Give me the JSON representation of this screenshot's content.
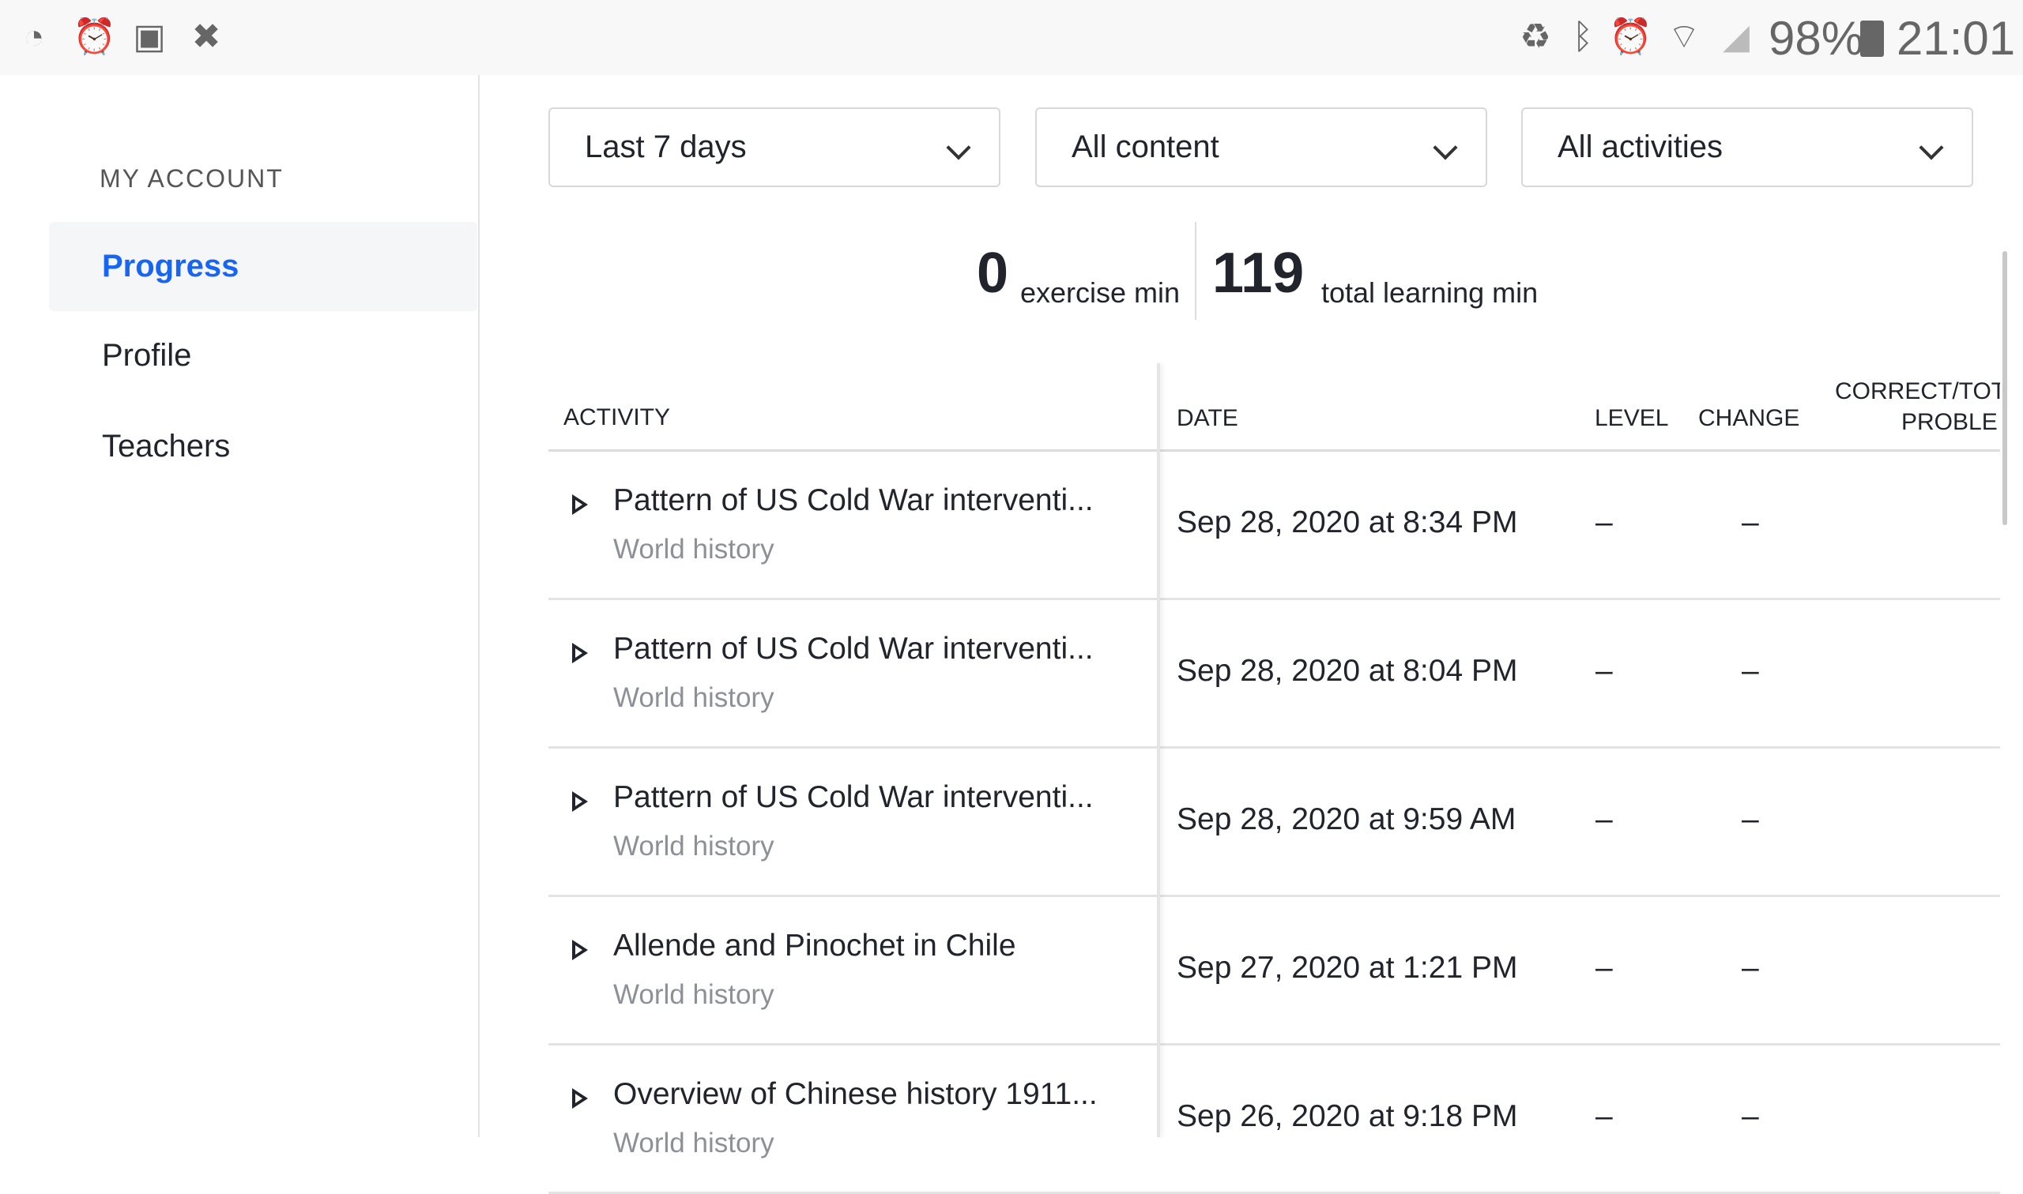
{
  "status_bar": {
    "left_icons": [
      "speedometer-icon",
      "alarm-icon",
      "image-icon",
      "file-x-icon"
    ],
    "right_icons": [
      "recycle-icon",
      "bluetooth-icon",
      "alarm-icon",
      "wifi-icon",
      "signal-icon"
    ],
    "battery": "98%",
    "time": "21:01"
  },
  "sidebar": {
    "heading": "MY ACCOUNT",
    "items": [
      {
        "label": "Progress",
        "active": true
      },
      {
        "label": "Profile"
      },
      {
        "label": "Teachers"
      }
    ]
  },
  "filters": [
    {
      "value": "Last 7 days"
    },
    {
      "value": "All content"
    },
    {
      "value": "All activities"
    }
  ],
  "stats": {
    "exercise_value": "0",
    "exercise_label": "exercise min",
    "total_value": "119",
    "total_label": "total learning min"
  },
  "table": {
    "headers": {
      "activity": "ACTIVITY",
      "date": "DATE",
      "level": "LEVEL",
      "change": "CHANGE",
      "correct_line1": "CORRECT/TOT",
      "correct_line2": "PROBLE"
    },
    "rows": [
      {
        "title": "Pattern of US Cold War interventi...",
        "subject": "World history",
        "date": "Sep 28, 2020 at 8:34 PM",
        "level": "–",
        "change": "–"
      },
      {
        "title": "Pattern of US Cold War interventi...",
        "subject": "World history",
        "date": "Sep 28, 2020 at 8:04 PM",
        "level": "–",
        "change": "–"
      },
      {
        "title": "Pattern of US Cold War interventi...",
        "subject": "World history",
        "date": "Sep 28, 2020 at 9:59 AM",
        "level": "–",
        "change": "–"
      },
      {
        "title": "Allende and Pinochet in Chile",
        "subject": "World history",
        "date": "Sep 27, 2020 at 1:21 PM",
        "level": "–",
        "change": "–"
      },
      {
        "title": "Overview of Chinese history 1911...",
        "subject": "World history",
        "date": "Sep 26, 2020 at 9:18 PM",
        "level": "–",
        "change": "–"
      }
    ]
  },
  "colors": {
    "accent": "#1865f2",
    "text": "#21242c",
    "subtle": "#8d9197"
  }
}
